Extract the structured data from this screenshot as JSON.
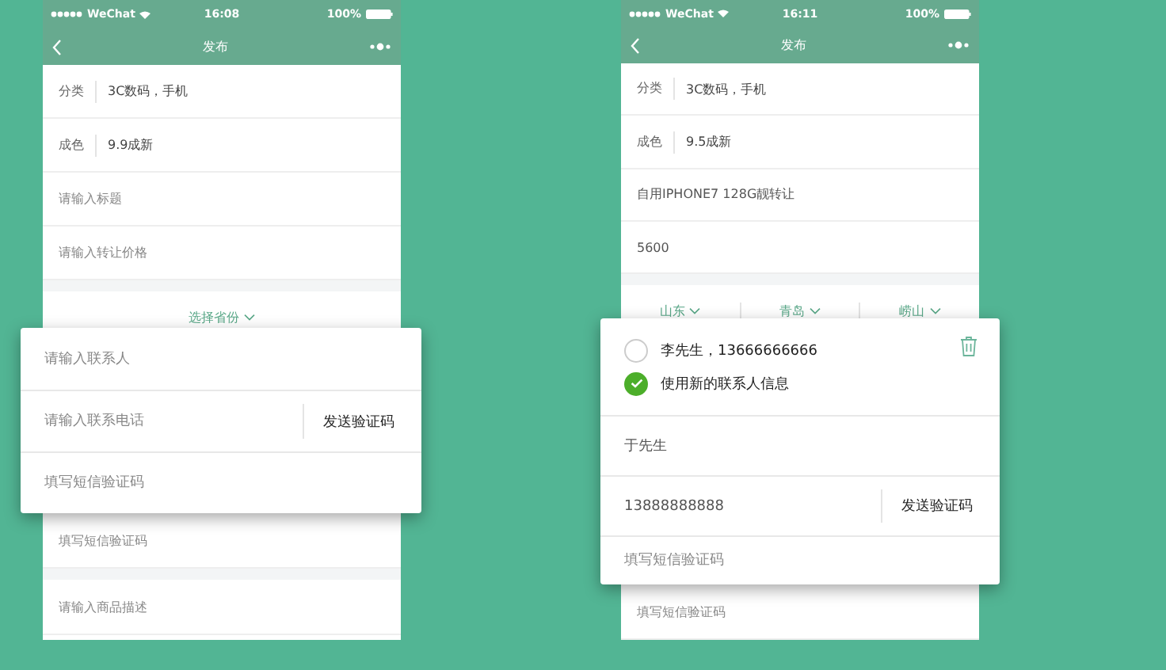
{
  "screens": [
    {
      "status": {
        "carrier": "WeChat",
        "time": "16:08",
        "battery": "100%"
      },
      "nav": {
        "title": "发布"
      },
      "fields": [
        {
          "label": "分类",
          "value": "3C数码，手机"
        },
        {
          "label": "成色",
          "value": "9.9成新"
        }
      ],
      "inputs": [
        {
          "placeholder": "请输入标题"
        },
        {
          "placeholder": "请输入转让价格"
        }
      ],
      "regions": [
        "选择省份"
      ],
      "lower_rows": [
        {
          "placeholder": "填写短信验证码"
        },
        {
          "placeholder": "请输入商品描述"
        }
      ],
      "popup": {
        "kind": "form",
        "rows": [
          {
            "placeholder": "请输入联系人"
          },
          {
            "placeholder": "请输入联系电话",
            "action": "发送验证码"
          },
          {
            "placeholder": "填写短信验证码"
          }
        ]
      }
    },
    {
      "status": {
        "carrier": "WeChat",
        "time": "16:11",
        "battery": "100%"
      },
      "nav": {
        "title": "发布"
      },
      "fields": [
        {
          "label": "分类",
          "value": "3C数码，手机"
        },
        {
          "label": "成色",
          "value": "9.5成新"
        }
      ],
      "inputs": [
        {
          "value": "自用IPHONE7 128G靓转让"
        },
        {
          "value": "5600"
        }
      ],
      "regions": [
        "山东",
        "青岛",
        "崂山"
      ],
      "lower_rows": [
        {
          "placeholder": "填写短信验证码"
        }
      ],
      "popup": {
        "kind": "contacts",
        "options": [
          {
            "label": "李先生，13666666666",
            "selected": false
          },
          {
            "label": "使用新的联系人信息",
            "selected": true
          }
        ],
        "rows": [
          {
            "value": "于先生"
          },
          {
            "value": "13888888888",
            "action": "发送验证码"
          },
          {
            "placeholder": "填写短信验证码"
          }
        ]
      }
    }
  ]
}
